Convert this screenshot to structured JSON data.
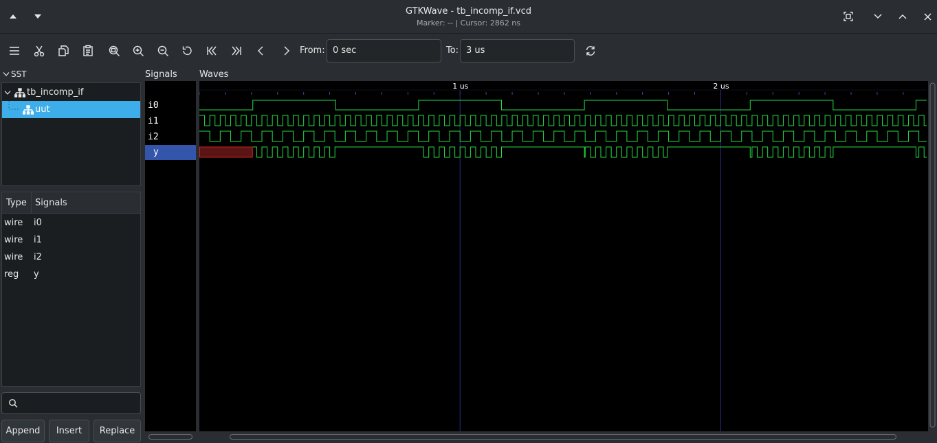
{
  "window": {
    "title": "GTKWave - tb_incomp_if.vcd",
    "subtitle": "Marker: --  |  Cursor: 2862 ns"
  },
  "toolbar": {
    "from_label": "From:",
    "from_value": "0 sec",
    "to_label": "To:",
    "to_value": "3 us"
  },
  "sst": {
    "label": "SST",
    "tree": [
      {
        "label": "tb_incomp_if",
        "expanded": true,
        "selected": false
      },
      {
        "label": "uut",
        "expanded": false,
        "selected": true
      }
    ]
  },
  "signals_table": {
    "headers": [
      "Type",
      "Signals"
    ],
    "rows": [
      {
        "type": "wire",
        "name": "i0"
      },
      {
        "type": "wire",
        "name": "i1"
      },
      {
        "type": "wire",
        "name": "i2"
      },
      {
        "type": "reg",
        "name": "y"
      }
    ]
  },
  "search": {
    "placeholder": ""
  },
  "buttons": {
    "append": "Append",
    "insert": "Insert",
    "replace": "Replace"
  },
  "panes": {
    "signals": "Signals",
    "waves": "Waves"
  },
  "signal_list": [
    {
      "name": "i0",
      "selected": false
    },
    {
      "name": "i1",
      "selected": false
    },
    {
      "name": "i2",
      "selected": false
    },
    {
      "name": "y",
      "selected": true
    }
  ],
  "waves": {
    "unit": "ns",
    "range": [
      0,
      2790
    ],
    "time_labels": [
      {
        "t": 1000,
        "label": "1 us"
      },
      {
        "t": 2000,
        "label": "2 us"
      }
    ],
    "traces": {
      "i0": {
        "initial": 0,
        "edges": [
          205,
          523,
          841,
          1159,
          1477,
          1795,
          2113,
          2431,
          2749
        ]
      },
      "i1": {
        "period": 40,
        "high_first": true
      },
      "i2": {
        "period": 80,
        "high_first": true
      },
      "y": {
        "unknown_until": 205,
        "segments": [
          {
            "from": 205,
            "to": 523,
            "follows": "i1"
          },
          {
            "from": 523,
            "to": 841,
            "level": 1
          },
          {
            "from": 841,
            "to": 1159,
            "follows": "i1"
          },
          {
            "from": 1159,
            "to": 1477,
            "level": 1
          },
          {
            "from": 1477,
            "to": 1795,
            "follows": "i1"
          },
          {
            "from": 1795,
            "to": 2113,
            "level": 1
          },
          {
            "from": 2113,
            "to": 2431,
            "follows": "i1"
          },
          {
            "from": 2431,
            "to": 2749,
            "level": 1
          },
          {
            "from": 2749,
            "to": 2790,
            "follows": "i1"
          }
        ]
      }
    },
    "colors": {
      "trace": "#22dd44",
      "unknown_fill": "#5a1414",
      "unknown_stroke": "#cc2222",
      "cursor_line": "#2a2a88",
      "ticks": "#3a4aa0"
    }
  }
}
